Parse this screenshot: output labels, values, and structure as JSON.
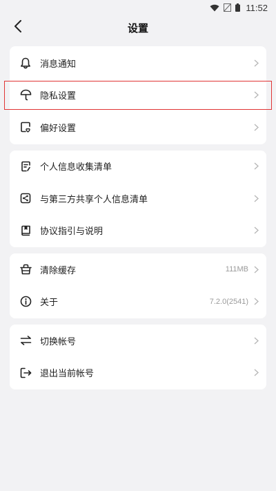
{
  "status_bar": {
    "time": "11:52",
    "icons": [
      "wifi-icon",
      "signal-icon",
      "battery-icon"
    ]
  },
  "header": {
    "title": "设置",
    "back_icon": "chevron-left-icon"
  },
  "groups": [
    {
      "items": [
        {
          "label": "消息通知",
          "icon": "bell-icon"
        },
        {
          "label": "隐私设置",
          "icon": "umbrella-icon",
          "highlighted": true
        },
        {
          "label": "偏好设置",
          "icon": "preference-icon"
        }
      ]
    },
    {
      "items": [
        {
          "label": "个人信息收集清单",
          "icon": "document-edit-icon"
        },
        {
          "label": "与第三方共享个人信息清单",
          "icon": "share-icon"
        },
        {
          "label": "协议指引与说明",
          "icon": "book-icon"
        }
      ]
    },
    {
      "items": [
        {
          "label": "清除缓存",
          "icon": "basket-icon",
          "value": "111MB"
        },
        {
          "label": "关于",
          "icon": "info-icon",
          "value": "7.2.0(2541)"
        }
      ]
    },
    {
      "items": [
        {
          "label": "切换帐号",
          "icon": "switch-icon"
        },
        {
          "label": "退出当前帐号",
          "icon": "logout-icon"
        }
      ]
    }
  ],
  "colors": {
    "background": "#f2f2f4",
    "card": "#ffffff",
    "highlight_border": "#e03434",
    "secondary_text": "#9a9a9a"
  }
}
